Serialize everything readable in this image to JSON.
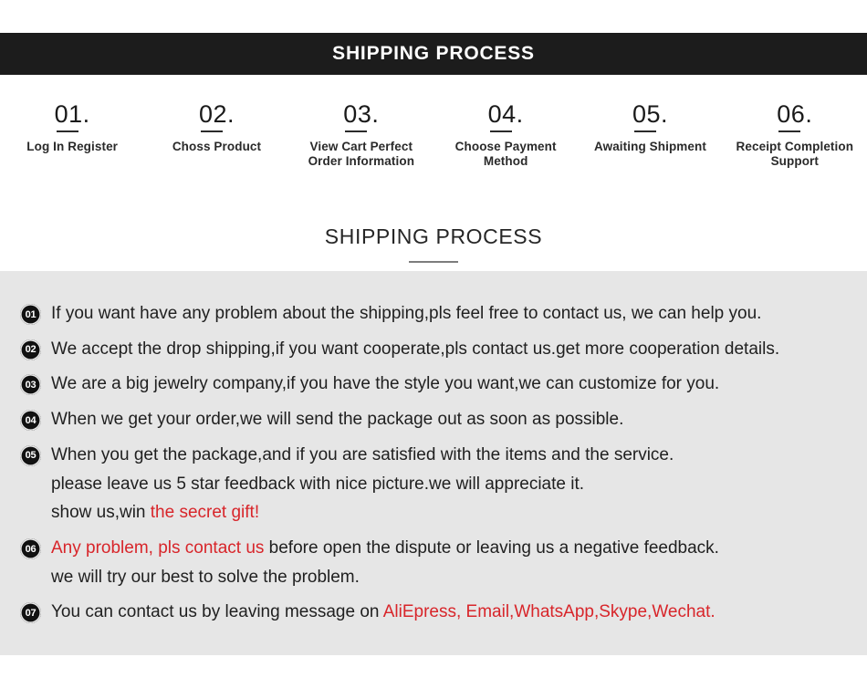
{
  "banner": {
    "title": "SHIPPING PROCESS"
  },
  "steps": [
    {
      "number": "01.",
      "label": "Log In Register"
    },
    {
      "number": "02.",
      "label": "Choss Product"
    },
    {
      "number": "03.",
      "label": "View Cart Perfect\nOrder Information"
    },
    {
      "number": "04.",
      "label": "Choose Payment\nMethod"
    },
    {
      "number": "05.",
      "label": "Awaiting Shipment"
    },
    {
      "number": "06.",
      "label": "Receipt Completion\nSupport"
    }
  ],
  "section": {
    "title": "SHIPPING PROCESS"
  },
  "items": [
    {
      "badge": "01",
      "lines": [
        [
          {
            "text": "If you want have any problem about the shipping,pls feel free to contact us, we can help you.",
            "color": "dark"
          }
        ]
      ]
    },
    {
      "badge": "02",
      "lines": [
        [
          {
            "text": "We accept the drop shipping,if you want cooperate,pls contact us.get more cooperation details.",
            "color": "dark"
          }
        ]
      ]
    },
    {
      "badge": "03",
      "lines": [
        [
          {
            "text": "We are a big jewelry company,if you have the style you want,we can customize for you.",
            "color": "dark"
          }
        ]
      ]
    },
    {
      "badge": "04",
      "lines": [
        [
          {
            "text": "When we get your order,we will send the package out as soon as possible.",
            "color": "dark"
          }
        ]
      ]
    },
    {
      "badge": "05",
      "lines": [
        [
          {
            "text": "When you get the package,and if you are satisfied with the items and the service.",
            "color": "dark"
          }
        ],
        [
          {
            "text": "please leave us 5 star feedback with nice picture.we will appreciate it.",
            "color": "dark"
          }
        ],
        [
          {
            "text": "show us,win ",
            "color": "dark"
          },
          {
            "text": "the secret gift!",
            "color": "red"
          }
        ]
      ]
    },
    {
      "badge": "06",
      "lines": [
        [
          {
            "text": "Any problem, pls contact us",
            "color": "red"
          },
          {
            "text": " before open the dispute or leaving us a negative feedback.",
            "color": "dark"
          }
        ],
        [
          {
            "text": "we will try our best to solve the problem.",
            "color": "dark"
          }
        ]
      ]
    },
    {
      "badge": "07",
      "lines": [
        [
          {
            "text": "You can contact us by leaving message on ",
            "color": "dark"
          },
          {
            "text": "AliEpress, Email,WhatsApp,Skype,Wechat.",
            "color": "red"
          }
        ]
      ]
    }
  ],
  "colors": {
    "banner_bg": "#1c1c1c",
    "panel_bg": "#e6e6e6",
    "page_bg": "#ffffff",
    "accent_red": "#d8252a",
    "text_dark": "#1f1f1f"
  }
}
